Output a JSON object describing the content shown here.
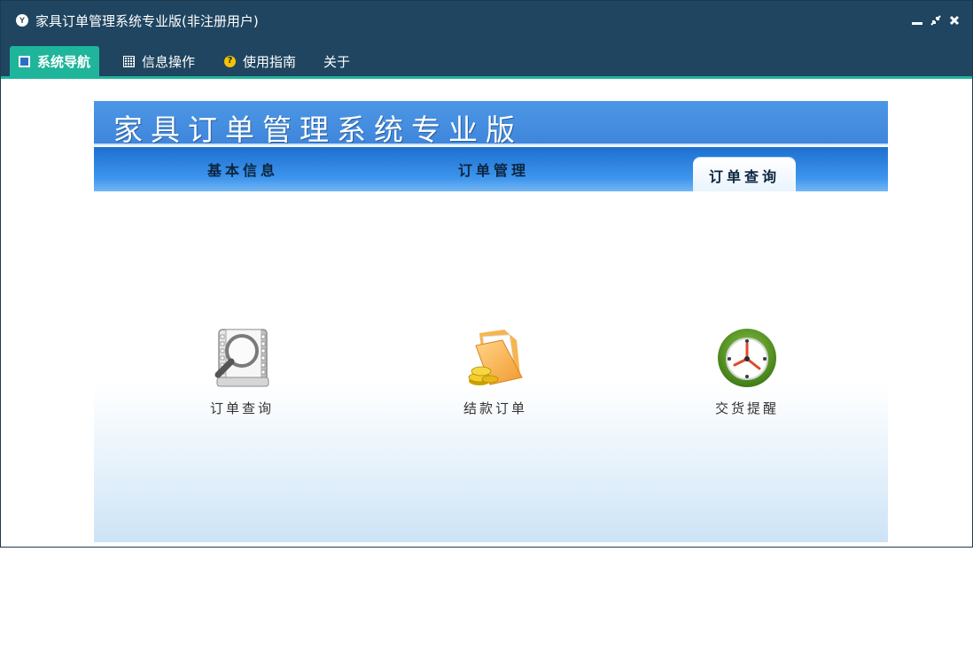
{
  "window": {
    "title": "家具订单管理系统专业版(非注册用户)",
    "app_icon_glyph": "Y"
  },
  "menubar": {
    "items": [
      {
        "label": "系统导航",
        "icon": "navigation-icon",
        "active": true
      },
      {
        "label": "信息操作",
        "icon": "grid-icon",
        "active": false
      },
      {
        "label": "使用指南",
        "icon": "help-icon",
        "active": false
      },
      {
        "label": "关于",
        "icon": "",
        "active": false
      }
    ]
  },
  "banner": {
    "title": "家具订单管理系统专业版"
  },
  "tabs": [
    {
      "label": "基本信息",
      "active": false
    },
    {
      "label": "订单管理",
      "active": false
    },
    {
      "label": "订单查询",
      "active": true
    }
  ],
  "features": [
    {
      "label": "订单查询",
      "icon": "magnifier-document-icon"
    },
    {
      "label": "结款订单",
      "icon": "folder-coins-icon"
    },
    {
      "label": "交货提醒",
      "icon": "clock-icon"
    }
  ],
  "colors": {
    "titlebar": "#1f4560",
    "accent": "#1fb59a",
    "banner_blue": "#4c97e5"
  }
}
